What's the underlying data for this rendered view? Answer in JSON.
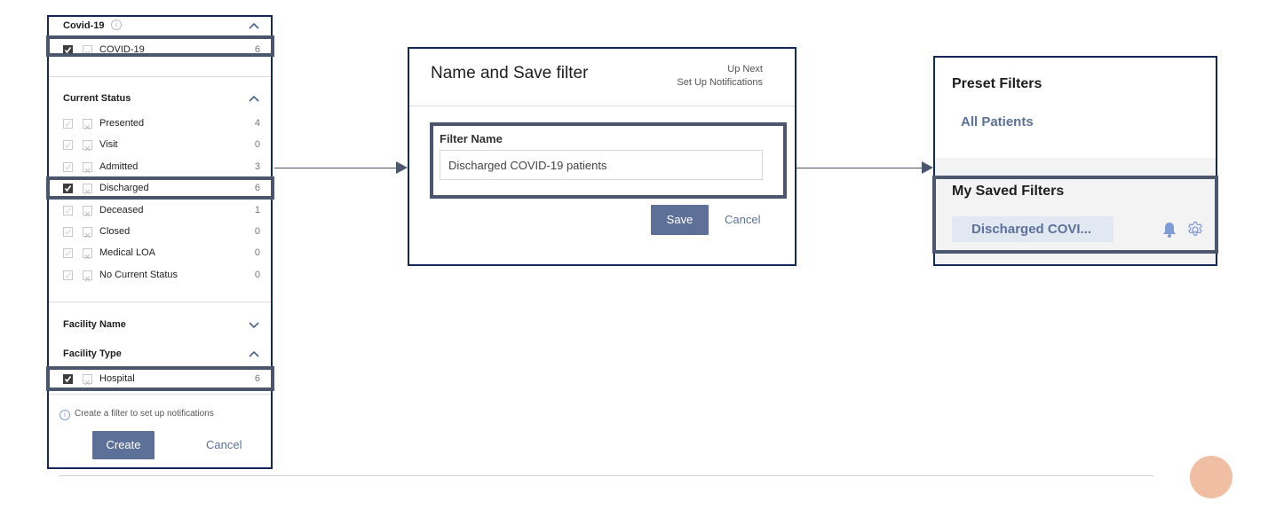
{
  "filter_panel": {
    "covid_section": {
      "title": "Covid-19",
      "items": [
        {
          "label": "COVID-19",
          "count": "6",
          "checked": true
        }
      ]
    },
    "status_section": {
      "title": "Current Status",
      "items": [
        {
          "label": "Presented",
          "count": "4",
          "checked": false
        },
        {
          "label": "Visit",
          "count": "0",
          "checked": false
        },
        {
          "label": "Admitted",
          "count": "3",
          "checked": false
        },
        {
          "label": "Discharged",
          "count": "6",
          "checked": true
        },
        {
          "label": "Deceased",
          "count": "1",
          "checked": false
        },
        {
          "label": "Closed",
          "count": "0",
          "checked": false
        },
        {
          "label": "Medical LOA",
          "count": "0",
          "checked": false
        },
        {
          "label": "No Current Status",
          "count": "0",
          "checked": false
        }
      ]
    },
    "facility_name_section": {
      "title": "Facility Name"
    },
    "facility_type_section": {
      "title": "Facility Type",
      "items": [
        {
          "label": "Hospital",
          "count": "6",
          "checked": true
        }
      ]
    },
    "info_text": "Create a filter to set up notifications",
    "create_label": "Create",
    "cancel_label": "Cancel"
  },
  "save_dialog": {
    "title": "Name and Save filter",
    "up_next_label": "Up Next",
    "up_next_value": "Set Up Notifications",
    "field_label": "Filter Name",
    "field_value": "Discharged COVID-19 patients",
    "save_label": "Save",
    "cancel_label": "Cancel"
  },
  "filters_panel": {
    "preset_title": "Preset Filters",
    "preset_items": [
      "All Patients"
    ],
    "saved_title": "My Saved Filters",
    "saved_items": [
      "Discharged COVI..."
    ]
  },
  "colors": {
    "frame": "#14285a",
    "highlight": "#4a566e",
    "accent": "#5d7198",
    "bell": "#7f9cd4",
    "dot": "#f0bfa3"
  }
}
